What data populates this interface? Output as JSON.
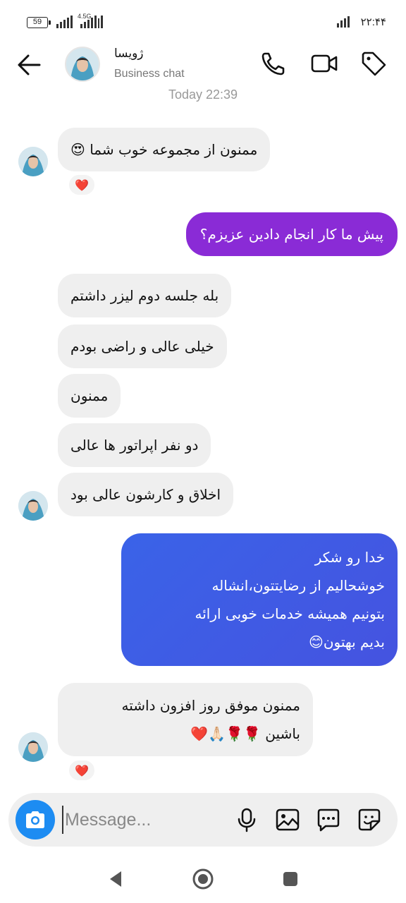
{
  "status_bar": {
    "battery": "59",
    "network": "4.5G",
    "time": "۲۲:۴۴"
  },
  "header": {
    "contact_name": "ژویسا",
    "subtitle": "Business chat"
  },
  "timestamp": "Today 22:39",
  "messages": [
    {
      "side": "in",
      "lines": [
        "ممنون از مجموعه خوب شما 😍"
      ],
      "reaction": "❤️"
    },
    {
      "side": "out",
      "lines": [
        "پیش ما کار انجام دادین عزیزم؟"
      ]
    },
    {
      "side": "in",
      "lines": [
        "بله جلسه دوم لیزر داشتم"
      ]
    },
    {
      "side": "in",
      "lines": [
        "خیلی عالی و راضی بودم"
      ]
    },
    {
      "side": "in",
      "lines": [
        "ممنون"
      ]
    },
    {
      "side": "in",
      "lines": [
        "دو نفر اپراتور ها عالی"
      ]
    },
    {
      "side": "in",
      "lines": [
        "اخلاق و کارشون عالی بود"
      ]
    },
    {
      "side": "out",
      "lines": [
        "خدا رو شکر",
        "خوشحالیم از رضایتتون،انشاله",
        "بتونیم همیشه خدمات خوبی ارائه",
        "بدیم بهتون😊"
      ]
    },
    {
      "side": "in",
      "lines": [
        "ممنون موفق  روز افزون داشته",
        "باشین 🌹🌹🙏🏻❤️"
      ],
      "reaction": "❤️"
    }
  ],
  "composer": {
    "placeholder": "Message..."
  },
  "colors": {
    "out_bubble_1": "#8a2bd6",
    "out_bubble_2": "#3d5ae6",
    "in_bubble": "#efefef",
    "camera": "#1d8cf2"
  }
}
